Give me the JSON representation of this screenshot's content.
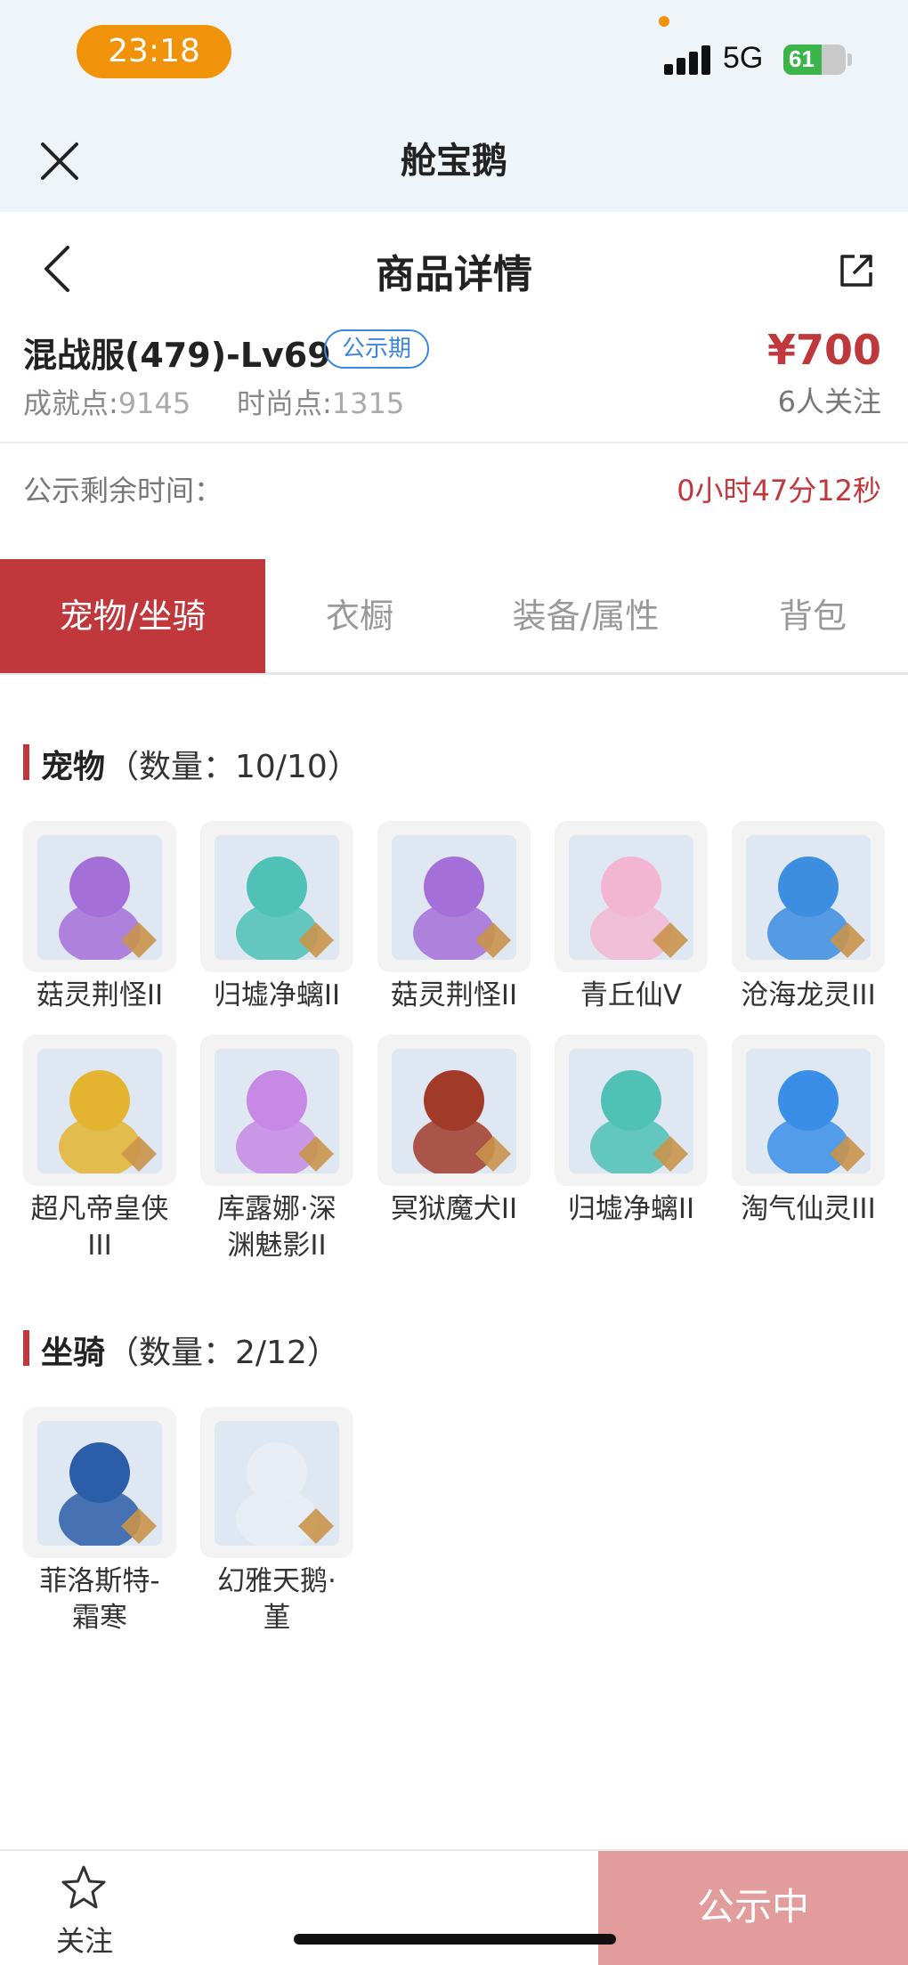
{
  "status_bar": {
    "time": "23:18",
    "network": "5G",
    "battery": "61",
    "battery_level": 0.61
  },
  "app_header": {
    "title": "舱宝鹅",
    "close_icon": "close-icon"
  },
  "nav": {
    "title": "商品详情",
    "back_icon": "back-arrow-icon",
    "share_icon": "share-icon"
  },
  "product": {
    "server": "混战服(479)-Lv69",
    "badge": "公示期",
    "achievement_label": "成就点:",
    "achievement_value": "9145",
    "fashion_label": "时尚点:",
    "fashion_value": "1315",
    "price": "¥700",
    "followers": "6人关注"
  },
  "countdown": {
    "label": "公示剩余时间：",
    "value": "0小时47分12秒"
  },
  "tabs": [
    {
      "label": "宠物/坐骑",
      "active": true
    },
    {
      "label": "衣橱",
      "active": false
    },
    {
      "label": "装备/属性",
      "active": false
    },
    {
      "label": "背包",
      "active": false
    }
  ],
  "pets_section": {
    "title": "宠物",
    "count": "（数量：10/10）",
    "items": [
      {
        "name": "菇灵荆怪II",
        "color": "#a46fd8"
      },
      {
        "name": "归墟净螭II",
        "color": "#4fc1b6"
      },
      {
        "name": "菇灵荆怪II",
        "color": "#a46fd8"
      },
      {
        "name": "青丘仙V",
        "color": "#f2b6d2"
      },
      {
        "name": "沧海龙灵III",
        "color": "#3d8de0"
      },
      {
        "name": "超凡帝皇侠III",
        "color": "#e4b431"
      },
      {
        "name": "库露娜·深渊魅影II",
        "color": "#c889e6"
      },
      {
        "name": "冥狱魔犬II",
        "color": "#a23a2a"
      },
      {
        "name": "归墟净螭II",
        "color": "#4fc1b6"
      },
      {
        "name": "淘气仙灵III",
        "color": "#3a8ee8"
      }
    ]
  },
  "mounts_section": {
    "title": "坐骑",
    "count": "（数量：2/12）",
    "items": [
      {
        "name": "菲洛斯特-霜寒",
        "color": "#2c5da8"
      },
      {
        "name": "幻雅天鹅·堇",
        "color": "#e9edf5"
      }
    ]
  },
  "bottom": {
    "follow_label": "关注",
    "status_button": "公示中"
  },
  "colors": {
    "accent_red": "#c0373c",
    "badge_blue": "#3b86e0",
    "status_orange": "#f0920a"
  }
}
